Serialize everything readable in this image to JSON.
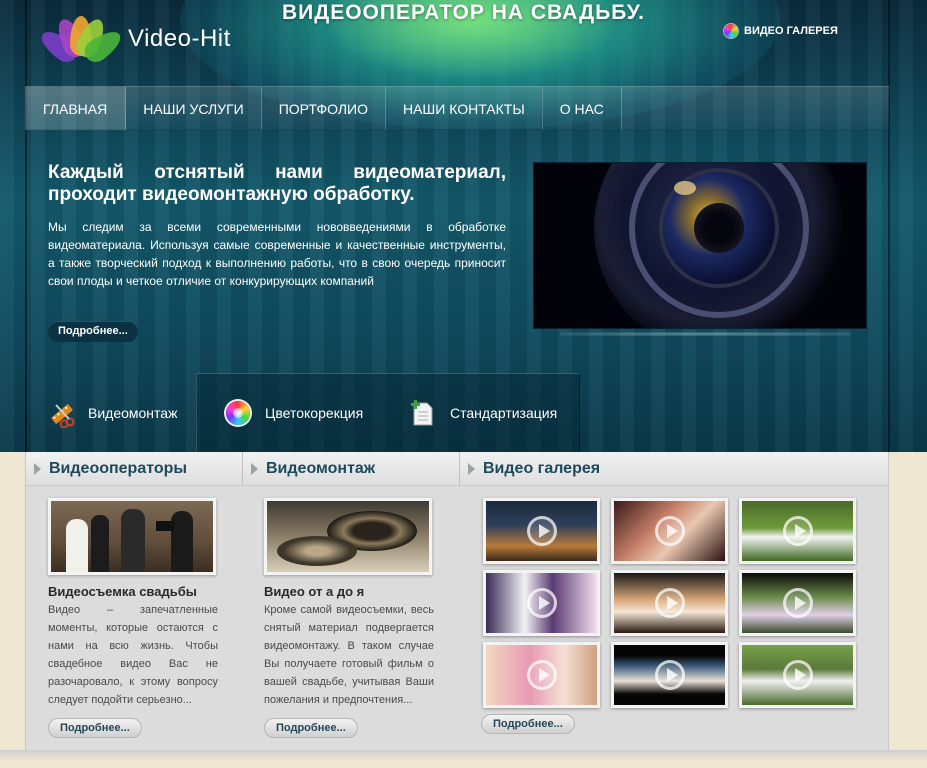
{
  "header": {
    "site_title": "ВИДЕООПЕРАТОР НА СВАДЬБУ.",
    "logo_text": "Video-Hit",
    "top_link": "ВИДЕО ГАЛЕРЕЯ"
  },
  "nav": {
    "items": [
      {
        "label": "ГЛАВНАЯ"
      },
      {
        "label": "НАШИ УСЛУГИ"
      },
      {
        "label": "ПОРТФОЛИО"
      },
      {
        "label": "НАШИ КОНТАКТЫ"
      },
      {
        "label": "О НАС"
      }
    ]
  },
  "feature": {
    "title": "Каждый отснятый нами видеоматериал, проходит видеомонтажную обработку.",
    "text": "Мы следим за всеми современными нововведениями в обработке видеоматериала. Используя самые современные и качественные инструменты, а также творческий подход к выполнению работы, что в свою очередь приносит свои плоды и четкое отличие от конкурирующих компаний",
    "more_label": "Подробнее..."
  },
  "tabs": [
    {
      "label": "Видеомонтаж",
      "icon": "scissors-film-icon"
    },
    {
      "label": "Цветокорекция",
      "icon": "color-wheel-icon"
    },
    {
      "label": "Стандартизация",
      "icon": "document-add-icon"
    }
  ],
  "columns": {
    "operators": {
      "heading": "Видеооператоры",
      "card_title": "Видеосъемка свадьбы",
      "card_text": "Видео – запечатленные моменты, которые остаются с нами на всю жизнь. Чтобы свадебное видео Вас не разочаровало, к этому вопросу следует подойти серьезно...",
      "more_label": "Подробнее..."
    },
    "editing": {
      "heading": "Видеомонтаж",
      "card_title": "Видео от а до я",
      "card_text": "Кроме самой видеосъемки, весь снятый материал подвергается видеомонтажу. В таком случае Вы получаете готовый фильм о вашей свадьбе, учитывая Ваши пожелания и предпочтения...",
      "more_label": "Подробнее..."
    },
    "gallery": {
      "heading": "Видео галерея",
      "more_label": "Подробнее...",
      "thumb_count": 9
    }
  },
  "colors": {
    "accent_heading": "#1c4a5c",
    "hero_dark": "#0f4658",
    "page_bg": "#efe7d2"
  }
}
